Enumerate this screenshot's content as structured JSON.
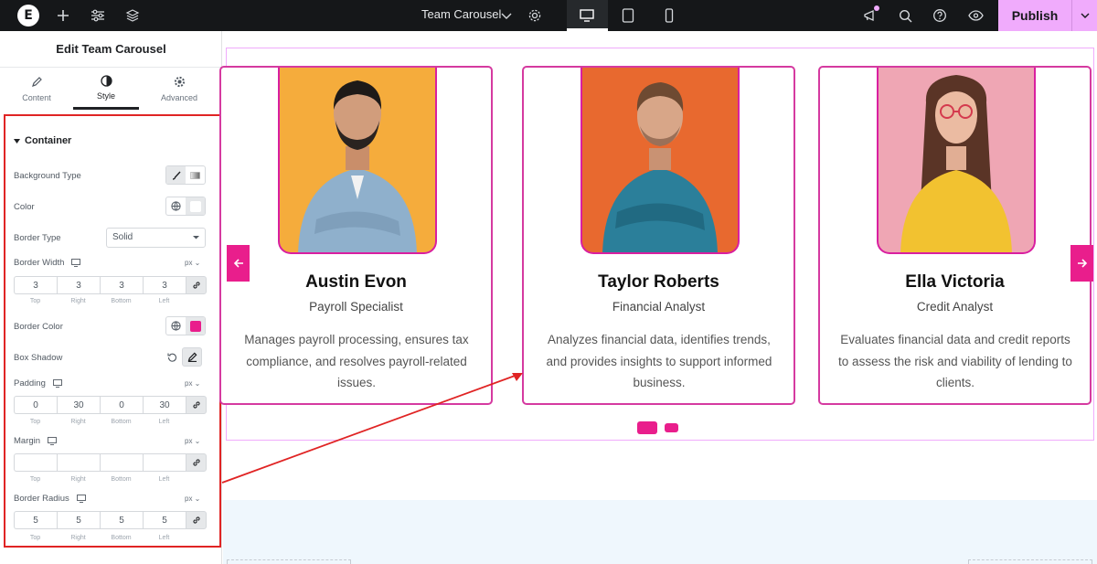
{
  "topbar": {
    "document_title": "Team Carousel",
    "publish_label": "Publish",
    "logo_letter": "E"
  },
  "panel": {
    "title": "Edit Team Carousel",
    "tabs": [
      {
        "label": "Content",
        "icon": "pencil-icon"
      },
      {
        "label": "Style",
        "icon": "half-circle-icon"
      },
      {
        "label": "Advanced",
        "icon": "gear-icon"
      }
    ],
    "active_tab": "Style",
    "section_title": "Container",
    "controls": {
      "background_type": "Background Type",
      "color": "Color",
      "border_type_label": "Border Type",
      "border_type_value": "Solid",
      "border_width": {
        "label": "Border Width",
        "unit": "px",
        "values": [
          "3",
          "3",
          "3",
          "3"
        ]
      },
      "border_color": {
        "label": "Border Color",
        "swatch": "#e91e8c"
      },
      "box_shadow": "Box Shadow",
      "padding": {
        "label": "Padding",
        "unit": "px",
        "values": [
          "0",
          "30",
          "0",
          "30"
        ]
      },
      "margin": {
        "label": "Margin",
        "unit": "px",
        "values": [
          "",
          "",
          "",
          ""
        ]
      },
      "border_radius": {
        "label": "Border Radius",
        "unit": "px",
        "values": [
          "5",
          "5",
          "5",
          "5"
        ]
      },
      "sides": [
        "Top",
        "Right",
        "Bottom",
        "Left"
      ]
    }
  },
  "cards": [
    {
      "name": "Austin Evon",
      "role": "Payroll Specialist",
      "description": "Manages payroll processing, ensures tax compliance, and resolves payroll-related issues.",
      "photo_bg": "#f5ac3c"
    },
    {
      "name": "Taylor Roberts",
      "role": "Financial Analyst",
      "description": "Analyzes financial data, identifies trends, and provides insights to support informed business.",
      "photo_bg": "#e8692f"
    },
    {
      "name": "Ella Victoria",
      "role": "Credit Analyst",
      "description": "Evaluates financial data and credit reports to assess the risk and viability of lending to clients.",
      "photo_bg": "#efa6b4"
    }
  ],
  "colors": {
    "accent": "#e91e8c",
    "publish_bg": "#f0abfc",
    "annotation_red": "#e02424",
    "topbar_bg": "#151719"
  }
}
